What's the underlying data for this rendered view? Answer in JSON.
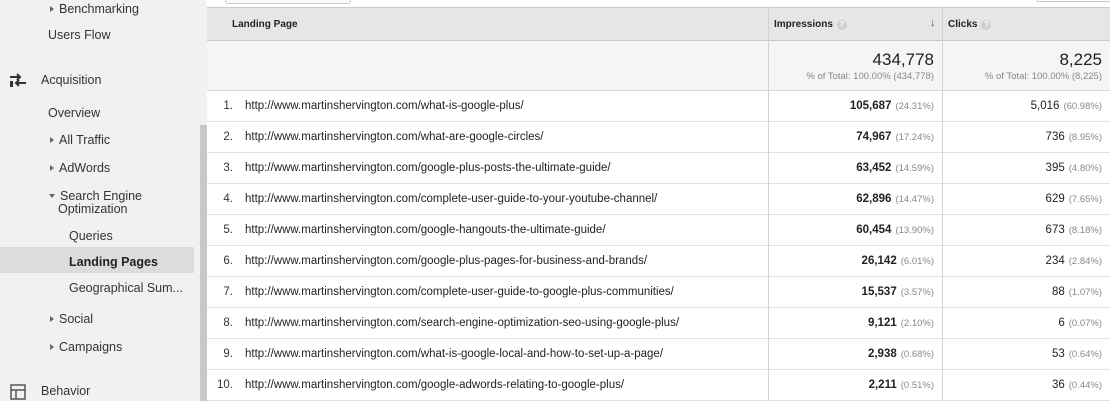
{
  "sidebar": {
    "benchmarking": "Benchmarking",
    "users_flow": "Users Flow",
    "acquisition": "Acquisition",
    "overview": "Overview",
    "all_traffic": "All Traffic",
    "adwords": "AdWords",
    "seo_line1": "Search Engine",
    "seo_line2": "Optimization",
    "queries": "Queries",
    "landing_pages": "Landing Pages",
    "geographical": "Geographical Sum...",
    "social": "Social",
    "campaigns": "Campaigns",
    "behavior": "Behavior"
  },
  "table": {
    "col_landing": "Landing Page",
    "col_impressions": "Impressions",
    "col_clicks": "Clicks",
    "help_glyph": "?",
    "sort_glyph": "↓",
    "totals": {
      "impressions": "434,778",
      "impressions_sub": "% of Total: 100.00% (434,778)",
      "clicks": "8,225",
      "clicks_sub": "% of Total: 100.00% (8,225)"
    },
    "rows": [
      {
        "idx": "1.",
        "url": "http://www.martinshervington.com/what-is-google-plus/",
        "imp": "105,687",
        "imp_pct": "(24.31%)",
        "clk": "5,016",
        "clk_pct": "(60.98%)"
      },
      {
        "idx": "2.",
        "url": "http://www.martinshervington.com/what-are-google-circles/",
        "imp": "74,967",
        "imp_pct": "(17.24%)",
        "clk": "736",
        "clk_pct": "(8.95%)"
      },
      {
        "idx": "3.",
        "url": "http://www.martinshervington.com/google-plus-posts-the-ultimate-guide/",
        "imp": "63,452",
        "imp_pct": "(14.59%)",
        "clk": "395",
        "clk_pct": "(4.80%)"
      },
      {
        "idx": "4.",
        "url": "http://www.martinshervington.com/complete-user-guide-to-your-youtube-channel/",
        "imp": "62,896",
        "imp_pct": "(14.47%)",
        "clk": "629",
        "clk_pct": "(7.65%)"
      },
      {
        "idx": "5.",
        "url": "http://www.martinshervington.com/google-hangouts-the-ultimate-guide/",
        "imp": "60,454",
        "imp_pct": "(13.90%)",
        "clk": "673",
        "clk_pct": "(8.18%)"
      },
      {
        "idx": "6.",
        "url": "http://www.martinshervington.com/google-plus-pages-for-business-and-brands/",
        "imp": "26,142",
        "imp_pct": "(6.01%)",
        "clk": "234",
        "clk_pct": "(2.84%)"
      },
      {
        "idx": "7.",
        "url": "http://www.martinshervington.com/complete-user-guide-to-google-plus-communities/",
        "imp": "15,537",
        "imp_pct": "(3.57%)",
        "clk": "88",
        "clk_pct": "(1.07%)"
      },
      {
        "idx": "8.",
        "url": "http://www.martinshervington.com/search-engine-optimization-seo-using-google-plus/",
        "imp": "9,121",
        "imp_pct": "(2.10%)",
        "clk": "6",
        "clk_pct": "(0.07%)"
      },
      {
        "idx": "9.",
        "url": "http://www.martinshervington.com/what-is-google-local-and-how-to-set-up-a-page/",
        "imp": "2,938",
        "imp_pct": "(0.68%)",
        "clk": "53",
        "clk_pct": "(0.64%)"
      },
      {
        "idx": "10.",
        "url": "http://www.martinshervington.com/google-adwords-relating-to-google-plus/",
        "imp": "2,211",
        "imp_pct": "(0.51%)",
        "clk": "36",
        "clk_pct": "(0.44%)"
      }
    ]
  },
  "icons": {
    "acquisition": "acquisition-icon",
    "behavior": "behavior-icon"
  }
}
